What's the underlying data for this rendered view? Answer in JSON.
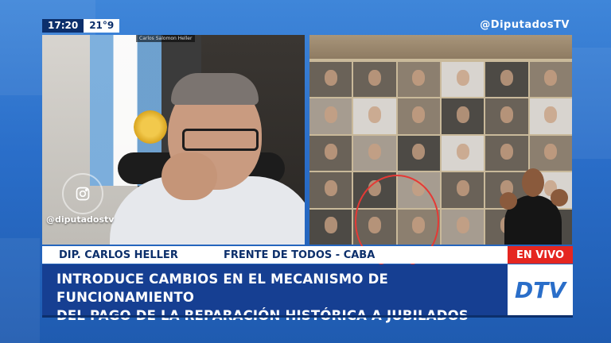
{
  "topbar": {
    "time": "17:20",
    "temperature": "21°9",
    "channel_handle": "@DiputadosTV"
  },
  "left_video": {
    "speaker_chip": "Carlos Salomon Heller",
    "instagram_handle": "@diputadostv"
  },
  "lower_third": {
    "name": "DIP. CARLOS HELLER",
    "party": "FRENTE DE TODOS - CABA",
    "live_label": "EN VIVO",
    "headline_line1": "INTRODUCE CAMBIOS EN EL MECANISMO DE FUNCIONAMIENTO",
    "headline_line2": "DEL PAGO DE LA REPARACIÓN HISTÓRICA A JUBILADOS",
    "logo_text": "DTV"
  },
  "colors": {
    "navy": "#0c2f6b",
    "headline_blue": "#163f92",
    "live_red": "#e52620",
    "accent_circle": "#e53935"
  }
}
